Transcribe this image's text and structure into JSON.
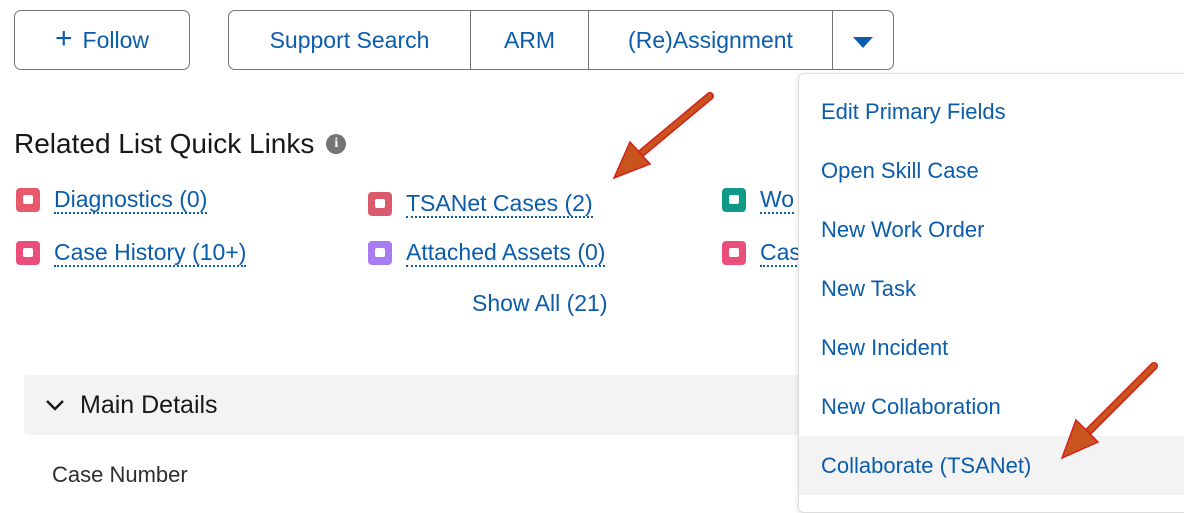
{
  "header": {
    "follow_plus": "+",
    "follow_label": "Follow",
    "buttons": [
      "Support Search",
      "ARM",
      "(Re)Assignment"
    ]
  },
  "quick_links": {
    "title": "Related List Quick Links",
    "info": "i",
    "items": [
      {
        "label": "Diagnostics (0)",
        "icon": "diagnostics-icon",
        "color": "#e8596b"
      },
      {
        "label": "TSANet Cases (2)",
        "icon": "tsanet-cases-icon",
        "color": "#d9596d"
      },
      {
        "label": "Wo",
        "icon": "work-orders-icon",
        "color": "#0e9a86"
      },
      {
        "label": "Case History (10+)",
        "icon": "case-history-icon",
        "color": "#ea4f7c"
      },
      {
        "label": "Attached Assets (0)",
        "icon": "attached-assets-icon",
        "color": "#a97cf1"
      },
      {
        "label": "Cas",
        "icon": "cases-icon",
        "color": "#ea4f7c"
      }
    ],
    "show_all": "Show All (21)"
  },
  "main_details": {
    "label": "Main Details",
    "case_number_label": "Case Number"
  },
  "dropdown_menu": {
    "items": [
      "Edit Primary Fields",
      "Open Skill Case",
      "New Work Order",
      "New Task",
      "New Incident",
      "New Collaboration",
      "Collaborate (TSANet)"
    ],
    "highlighted_item": "Collaborate (TSANet)"
  },
  "colors": {
    "link": "#0b5cab",
    "annotation_arrow": "#c9541d",
    "annotation_outline": "#d4201c"
  }
}
